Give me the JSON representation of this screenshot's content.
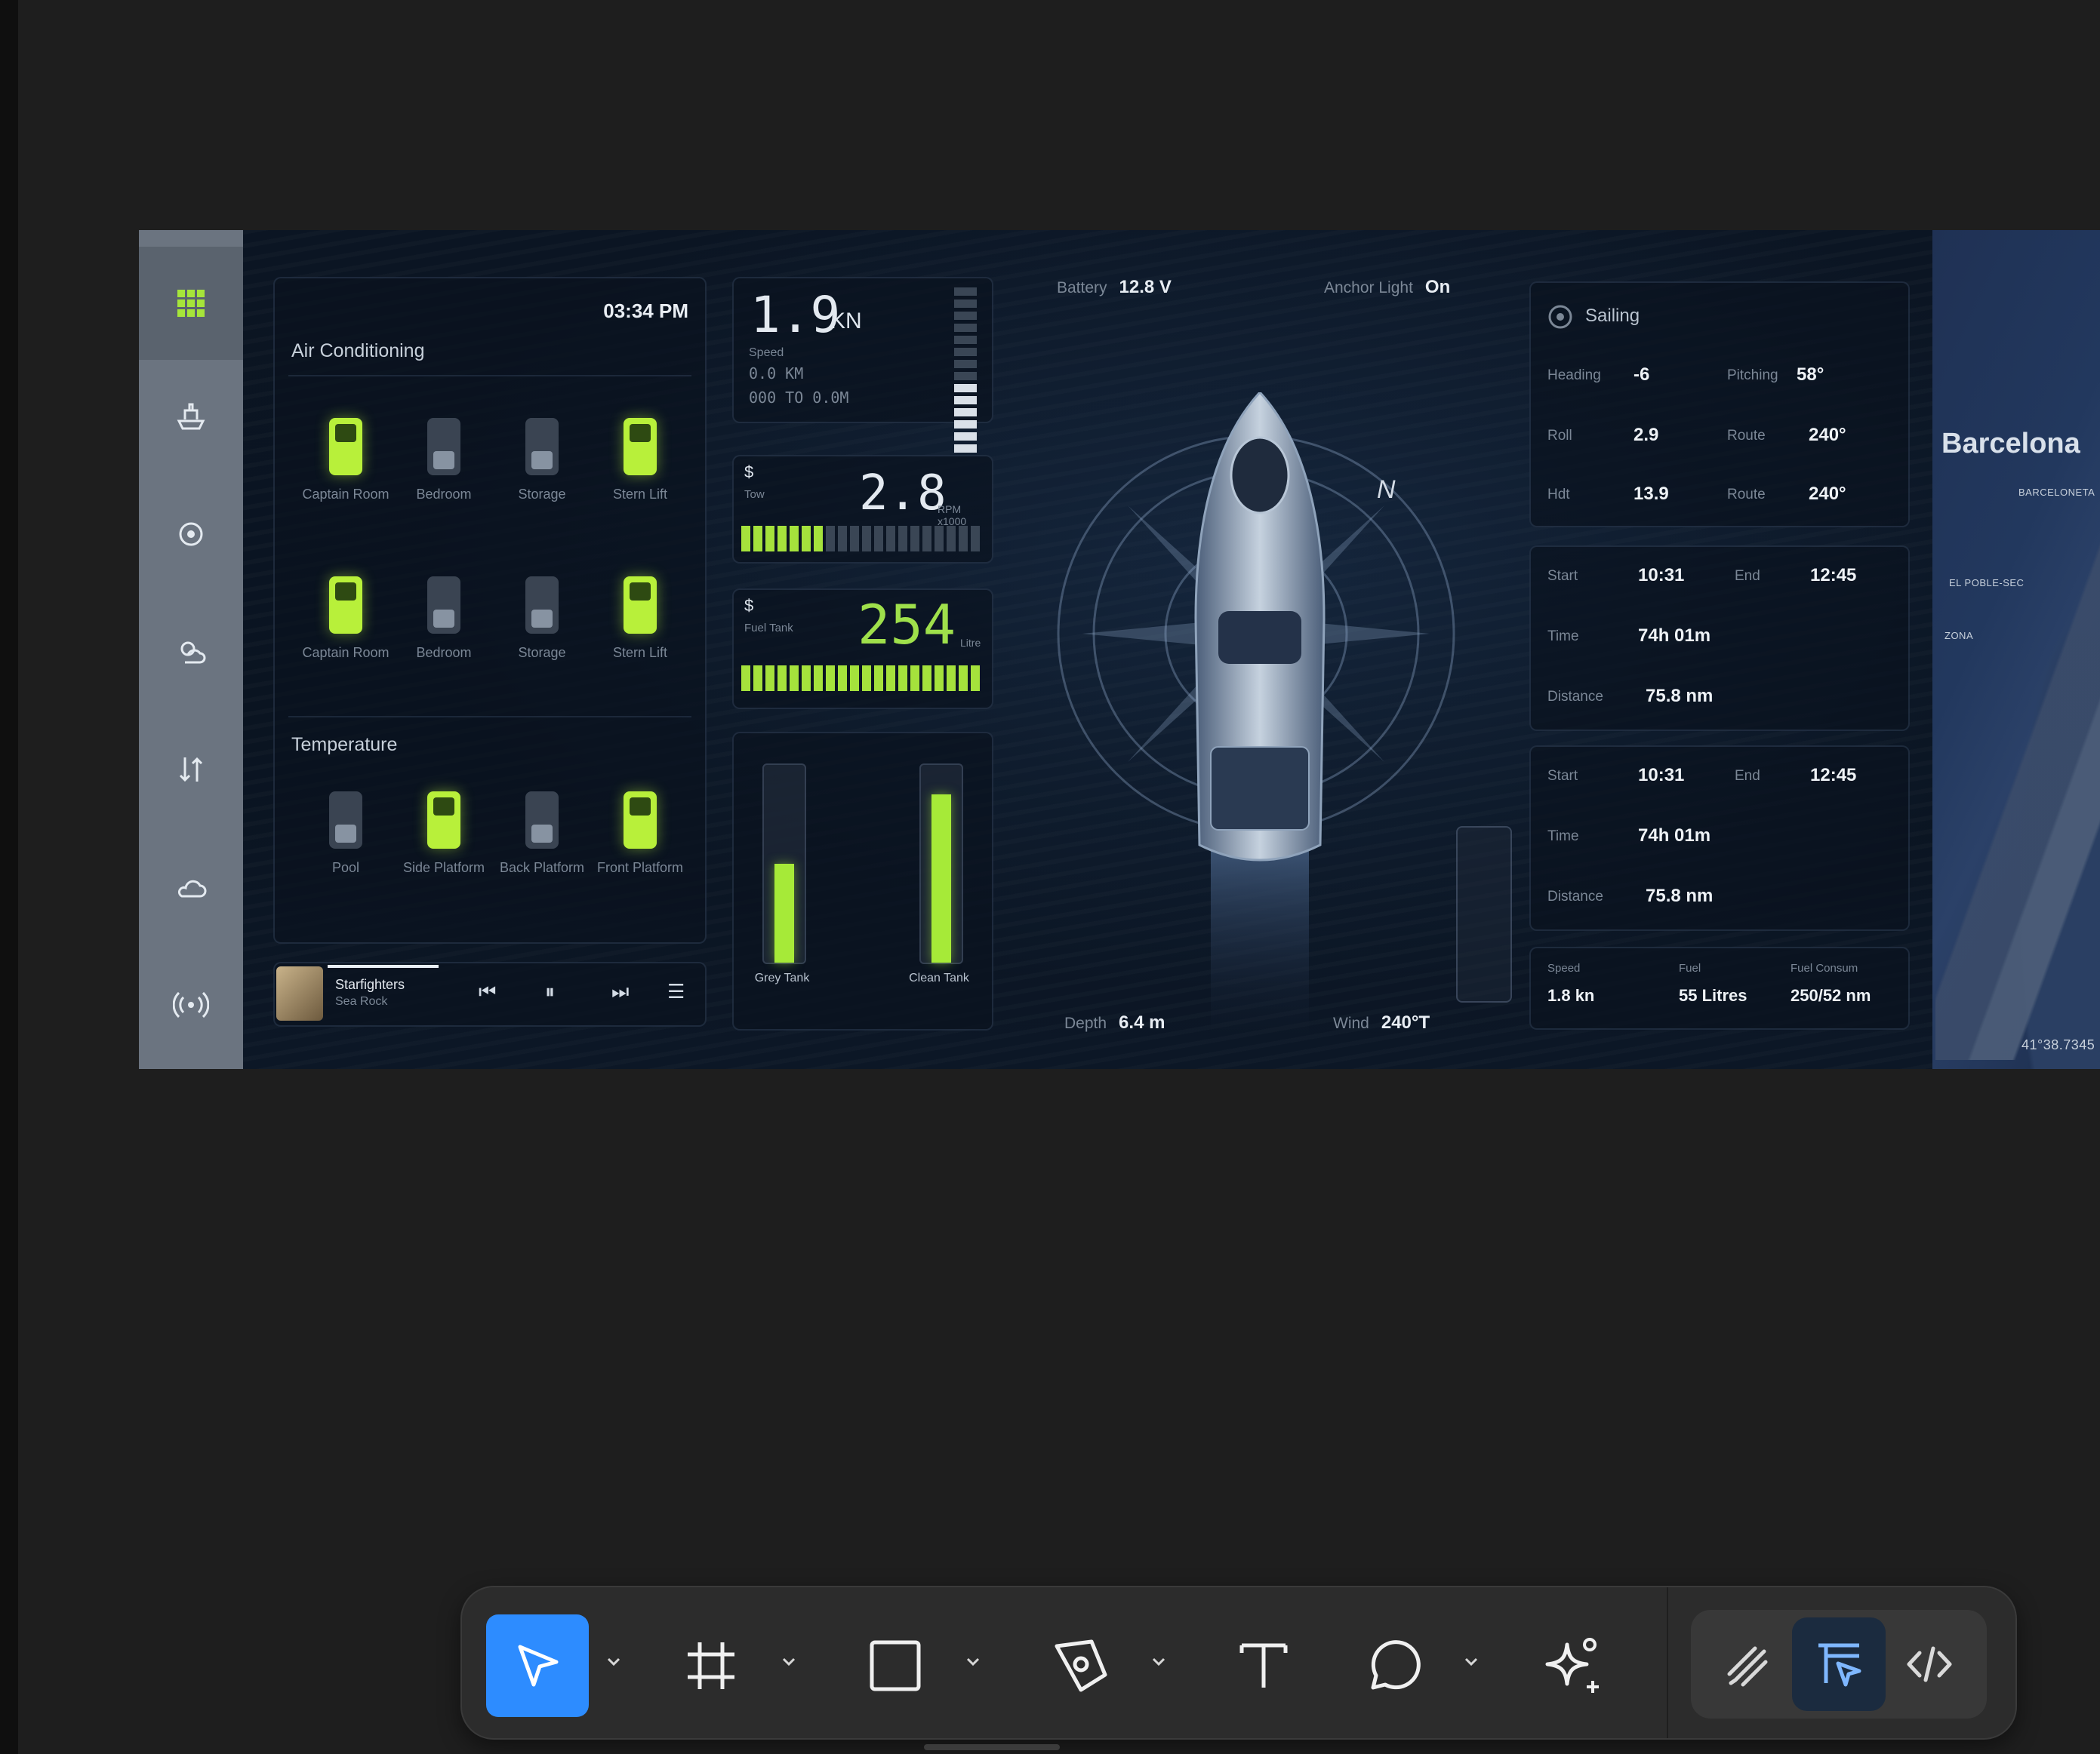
{
  "dashboard": {
    "time": "03:34 PM",
    "air_conditioning": {
      "title": "Air Conditioning",
      "zones": [
        {
          "label": "Captain Room",
          "on": true
        },
        {
          "label": "Bedroom",
          "on": false
        },
        {
          "label": "Storage",
          "on": false
        },
        {
          "label": "Stern Lift",
          "on": true
        },
        {
          "label": "Captain Room",
          "on": true
        },
        {
          "label": "Bedroom",
          "on": false
        },
        {
          "label": "Storage",
          "on": false
        },
        {
          "label": "Stern Lift",
          "on": true
        }
      ]
    },
    "temperature": {
      "title": "Temperature",
      "zones": [
        {
          "label": "Pool",
          "on": false
        },
        {
          "label": "Side Platform",
          "on": true
        },
        {
          "label": "Back Platform",
          "on": false
        },
        {
          "label": "Front Platform",
          "on": true
        }
      ]
    },
    "player": {
      "song": "Starfighters",
      "artist": "Sea Rock",
      "progress": 0.35
    },
    "speed": {
      "value": "1.9",
      "unit": "KN",
      "label": "Speed",
      "line1": "0.0 KM",
      "line2": "000 TO 0.0M",
      "level": 0.4
    },
    "rpm": {
      "icon": "$",
      "label": "Tow",
      "value": "2.8",
      "unit": "RPM x1000",
      "level": 0.35
    },
    "fuel": {
      "icon": "$",
      "label": "Fuel Tank",
      "value": "254",
      "unit": "Litre",
      "level": 1.0
    },
    "tanks": [
      {
        "label": "Grey Tank",
        "level": 0.5
      },
      {
        "label": "Clean Tank",
        "level": 0.85
      }
    ],
    "battery": {
      "label": "Battery",
      "value": "12.8 V"
    },
    "anchor_light": {
      "label": "Anchor Light",
      "value": "On"
    },
    "depth": {
      "label": "Depth",
      "value": "6.4 m"
    },
    "wind": {
      "label": "Wind",
      "value": "240°T"
    },
    "compass_north": "N",
    "sailing": {
      "title": "Sailing",
      "rows": [
        [
          {
            "k": "Heading",
            "v": "-6"
          },
          {
            "k": "Pitching",
            "v": "58°"
          }
        ],
        [
          {
            "k": "Roll",
            "v": "2.9"
          },
          {
            "k": "Route",
            "v": "240°"
          }
        ],
        [
          {
            "k": "Hdt",
            "v": "13.9"
          },
          {
            "k": "Route",
            "v": "240°"
          }
        ]
      ]
    },
    "trips": [
      {
        "start_k": "Start",
        "start": "10:31",
        "end_k": "End",
        "end": "12:45",
        "time_k": "Time",
        "time": "74h 01m",
        "dist_k": "Distance",
        "dist": "75.8 nm"
      },
      {
        "start_k": "Start",
        "start": "10:31",
        "end_k": "End",
        "end": "12:45",
        "time_k": "Time",
        "time": "74h 01m",
        "dist_k": "Distance",
        "dist": "75.8 nm"
      }
    ],
    "stats": [
      {
        "k": "Speed",
        "v": "1.8 kn"
      },
      {
        "k": "Fuel",
        "v": "55 Litres"
      },
      {
        "k": "Fuel Consum",
        "v": "250/52 nm"
      }
    ],
    "map": {
      "city": "Barcelona",
      "labels": [
        "BARCELONETA",
        "EL POBLE-SEC",
        "ZONA"
      ],
      "coords": "41°38.7345"
    }
  },
  "toolbar": {
    "tools": [
      "move-tool",
      "frame-tool",
      "shape-tool",
      "pen-tool",
      "text-tool",
      "comment-tool",
      "ai-tool"
    ],
    "modes": [
      "draw-mode",
      "design-mode",
      "dev-mode"
    ],
    "selected_tool": "move-tool",
    "selected_mode": "design-mode"
  },
  "colors": {
    "accent": "#a6e53a",
    "selection": "#2d8cff",
    "canvas": "#1e1e1e"
  }
}
